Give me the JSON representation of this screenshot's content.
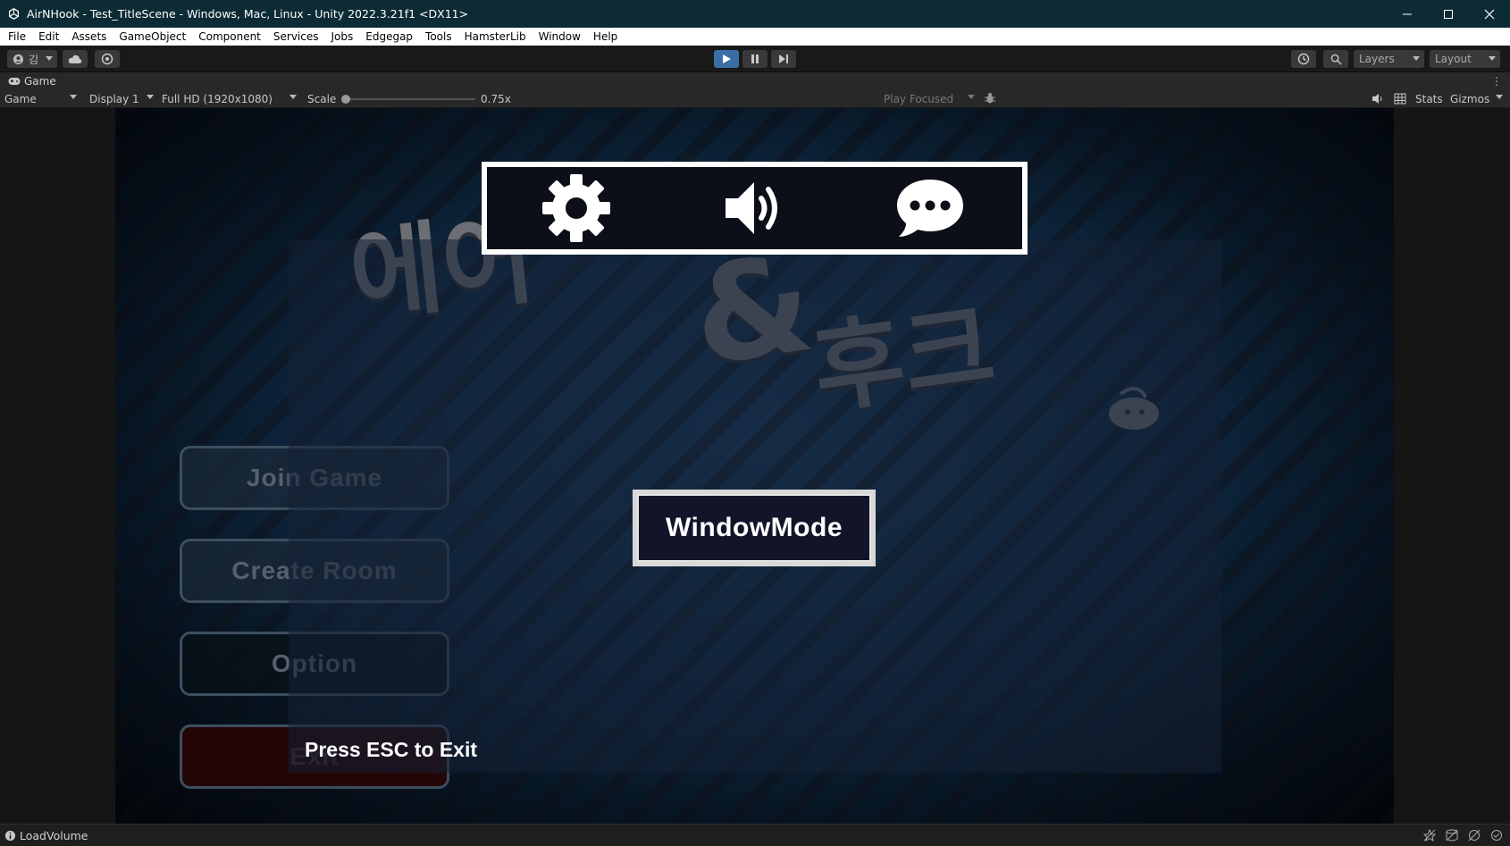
{
  "titlebar": {
    "title": "AirNHook - Test_TitleScene - Windows, Mac, Linux - Unity 2022.3.21f1 <DX11>",
    "minimize": "─",
    "maximize": "☐",
    "close": "✕"
  },
  "menubar": {
    "items": [
      "File",
      "Edit",
      "Assets",
      "GameObject",
      "Component",
      "Services",
      "Jobs",
      "Edgegap",
      "Tools",
      "HamsterLib",
      "Window",
      "Help"
    ]
  },
  "toolbar": {
    "account_label": "김",
    "layers_label": "Layers",
    "layout_label": "Layout",
    "play_active_color": "#3a6ea5"
  },
  "tab": {
    "label": "Game"
  },
  "gamebar": {
    "view_mode": "Game",
    "display": "Display 1",
    "resolution": "Full HD (1920x1080)",
    "scale_label": "Scale",
    "scale_value": "0.75x",
    "play_mode": "Play Focused",
    "stats": "Stats",
    "gizmos": "Gizmos"
  },
  "game": {
    "logo_line1": "에어",
    "logo_amp": "&",
    "logo_line2": "후크",
    "menu": {
      "join": "Join Game",
      "create": "Create Room",
      "option": "Option",
      "exit": "Exit"
    },
    "window_mode": "WindowMode",
    "press_esc": "Press ESC to Exit",
    "icons": [
      "gear-icon",
      "speaker-icon",
      "chat-icon"
    ]
  },
  "statusbar": {
    "text": "LoadVolume"
  }
}
